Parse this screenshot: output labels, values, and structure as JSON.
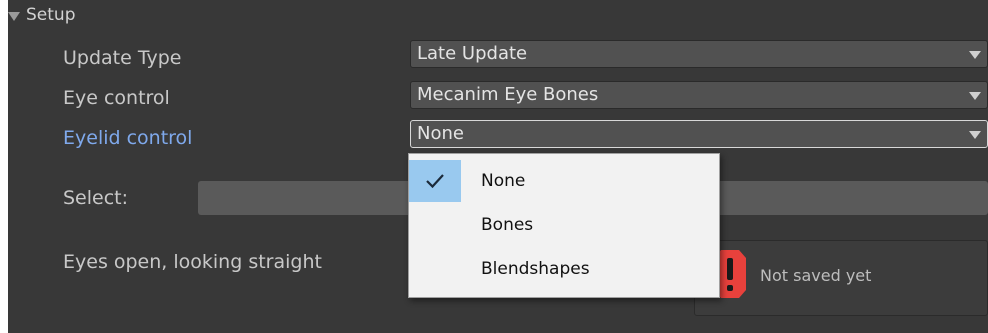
{
  "section": {
    "title": "Setup"
  },
  "fields": {
    "update_type": {
      "label": "Update Type",
      "value": "Late Update"
    },
    "eye_control": {
      "label": "Eye control",
      "value": "Mecanim Eye Bones"
    },
    "eyelid_control": {
      "label": "Eyelid control",
      "value": "None"
    },
    "select": {
      "label": "Select:"
    },
    "eyes_open": {
      "label": "Eyes open, looking straight"
    }
  },
  "notice": {
    "text": "Not saved yet",
    "icon": "warning-icon"
  },
  "dropdown_menu": {
    "items": [
      {
        "label": "None",
        "selected": true
      },
      {
        "label": "Bones",
        "selected": false
      },
      {
        "label": "Blendshapes",
        "selected": false
      }
    ]
  },
  "colors": {
    "panel_bg": "#383838",
    "active_label": "#7fa9ec",
    "menu_highlight": "#99c9ef",
    "warning": "#e8413c"
  }
}
